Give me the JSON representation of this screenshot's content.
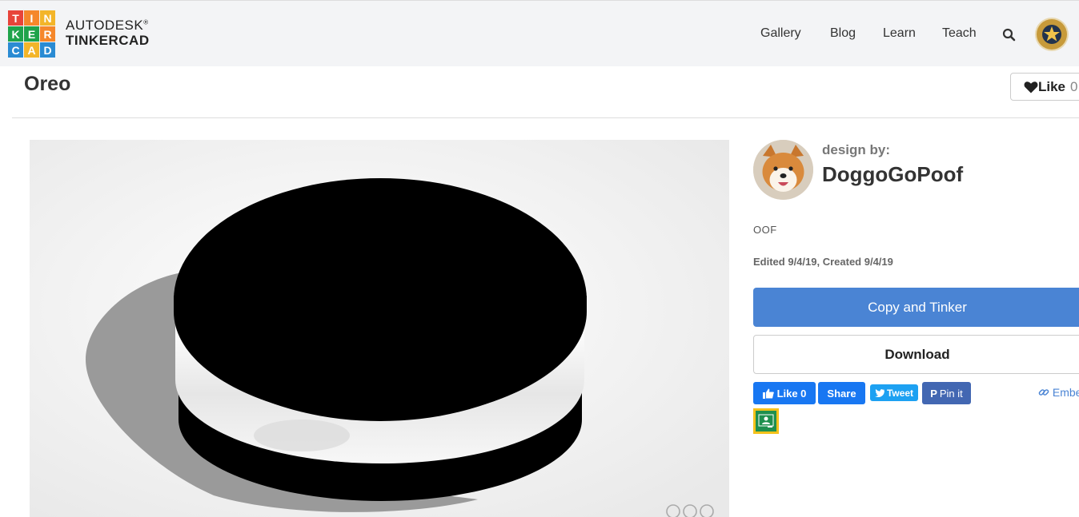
{
  "header": {
    "logo_letters": [
      "T",
      "I",
      "N",
      "K",
      "E",
      "R",
      "C",
      "A",
      "D"
    ],
    "logo_colors": [
      "#e8443a",
      "#f5872b",
      "#f3b529",
      "#1fa34a",
      "#1fa34a",
      "#f5872b",
      "#2a8bd3",
      "#f3b529",
      "#2a8bd3"
    ],
    "brand_top": "AUTODESK",
    "brand_bottom": "TINKERCAD",
    "nav": {
      "gallery": "Gallery",
      "blog": "Blog",
      "learn": "Learn",
      "teach": "Teach"
    }
  },
  "design": {
    "title": "Oreo",
    "like_label": "Like",
    "like_count": "0",
    "design_by": "design by:",
    "designer": "DoggoGoPoof",
    "description": "OOF",
    "dates": "Edited 9/4/19, Created 9/4/19"
  },
  "actions": {
    "copy": "Copy and Tinker",
    "download": "Download"
  },
  "share": {
    "fb_like": "Like 0",
    "fb_share": "Share",
    "tweet": "Tweet",
    "pin": "Pin it",
    "embed": "Embed"
  },
  "colors": {
    "primary": "#4a84d4",
    "facebook": "#1877f2",
    "twitter": "#1da1f2",
    "pinterest": "#4267b2",
    "classroom_border": "#f4c21b"
  },
  "icons": [
    "search-icon",
    "heart-icon",
    "fb-thumb-icon",
    "twitter-bird-icon",
    "pinterest-icon",
    "link-icon",
    "google-classroom-icon",
    "cc-license-icon"
  ]
}
